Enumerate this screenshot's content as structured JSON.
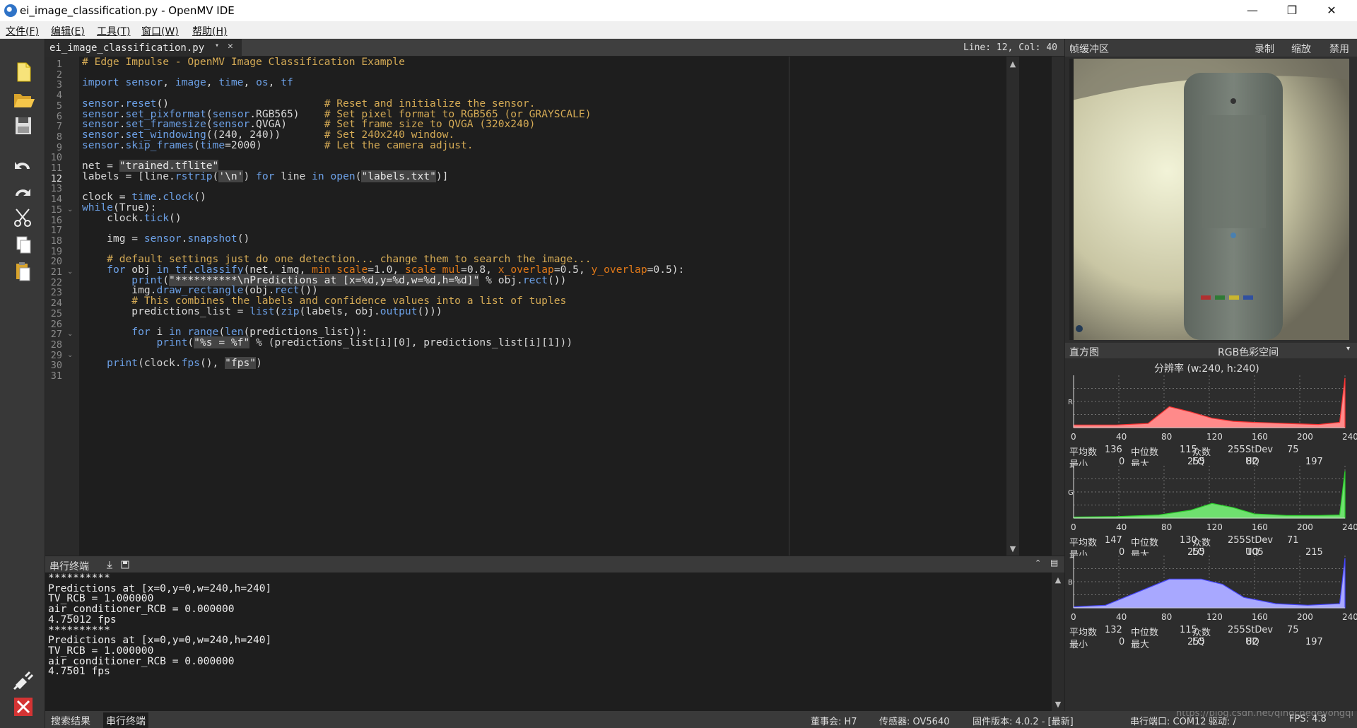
{
  "window": {
    "title": "ei_image_classification.py - OpenMV IDE"
  },
  "menu": [
    "文件(F)",
    "编辑(E)",
    "工具(T)",
    "窗口(W)",
    "帮助(H)"
  ],
  "tab": {
    "name": "ei_image_classification.py",
    "position": "Line: 12, Col: 40"
  },
  "editor": {
    "line_numbers": [
      "1",
      "2",
      "3",
      "4",
      "5",
      "6",
      "7",
      "8",
      "9",
      "10",
      "11",
      "12",
      "13",
      "14",
      "15",
      "16",
      "17",
      "18",
      "19",
      "20",
      "21",
      "22",
      "23",
      "24",
      "25",
      "26",
      "27",
      "28",
      "29",
      "30",
      "31"
    ],
    "lines": [
      "# Edge Impulse - OpenMV Image Classification Example",
      "",
      "import sensor, image, time, os, tf",
      "",
      "sensor.reset()                         # Reset and initialize the sensor.",
      "sensor.set_pixformat(sensor.RGB565)    # Set pixel format to RGB565 (or GRAYSCALE)",
      "sensor.set_framesize(sensor.QVGA)      # Set frame size to QVGA (320x240)",
      "sensor.set_windowing((240, 240))       # Set 240x240 window.",
      "sensor.skip_frames(time=2000)          # Let the camera adjust.",
      "",
      "net = \"trained.tflite\"",
      "labels = [line.rstrip('\\n') for line in open(\"labels.txt\")]",
      "",
      "clock = time.clock()",
      "while(True):",
      "    clock.tick()",
      "",
      "    img = sensor.snapshot()",
      "",
      "    # default settings just do one detection... change them to search the image...",
      "    for obj in tf.classify(net, img, min_scale=1.0, scale_mul=0.8, x_overlap=0.5, y_overlap=0.5):",
      "        print(\"**********\\nPredictions at [x=%d,y=%d,w=%d,h=%d]\" % obj.rect())",
      "        img.draw_rectangle(obj.rect())",
      "        # This combines the labels and confidence values into a list of tuples",
      "        predictions_list = list(zip(labels, obj.output()))",
      "",
      "        for i in range(len(predictions_list)):",
      "            print(\"%s = %f\" % (predictions_list[i][0], predictions_list[i][1]))",
      "",
      "    print(clock.fps(), \"fps\")",
      ""
    ]
  },
  "terminal": {
    "title": "串行终端",
    "lines": [
      "**********",
      "Predictions at [x=0,y=0,w=240,h=240]",
      "TV_RCB = 1.000000",
      "air_conditioner_RCB = 0.000000",
      "4.75012 fps",
      "**********",
      "Predictions at [x=0,y=0,w=240,h=240]",
      "TV_RCB = 1.000000",
      "air_conditioner_RCB = 0.000000",
      "4.7501 fps"
    ]
  },
  "bottom_tabs": [
    "搜索结果",
    "串行终端"
  ],
  "status": {
    "board": "董事会: H7",
    "sensor": "传感器: OV5640",
    "firmware": "固件版本: 4.0.2 - [最新]",
    "port": "串行端口: COM12",
    "drive": "驱动: /",
    "fps": "FPS: 4.8",
    "watermark": "https://blog.csdn.net/qingchedeyongqi"
  },
  "framebuffer": {
    "title": "帧缓冲区",
    "buttons": [
      "录制",
      "缩放",
      "禁用"
    ]
  },
  "histogram": {
    "title": "直方图",
    "colorspace": "RGB色彩空间",
    "resolution": "分辨率 (w:240, h:240)",
    "axis_ticks": [
      "0",
      "40",
      "80",
      "120",
      "160",
      "200",
      "240"
    ],
    "channels": [
      {
        "label": "R",
        "color": "#ff8a8a",
        "line": "#ff3333",
        "stats": {
          "mean": "136",
          "median": "115",
          "mode": "255",
          "stdev": "75",
          "min": "0",
          "max": "255",
          "lq": "82",
          "uq": "197"
        }
      },
      {
        "label": "G",
        "color": "#6fe06f",
        "line": "#2ccd2c",
        "stats": {
          "mean": "147",
          "median": "130",
          "mode": "255",
          "stdev": "71",
          "min": "0",
          "max": "255",
          "lq": "105",
          "uq": "215"
        }
      },
      {
        "label": "B",
        "color": "#a8a8ff",
        "line": "#4444ff",
        "stats": {
          "mean": "132",
          "median": "115",
          "mode": "255",
          "stdev": "75",
          "min": "0",
          "max": "255",
          "lq": "82",
          "uq": "197"
        }
      }
    ],
    "stat_labels": {
      "mean": "平均数",
      "median": "中位数",
      "mode": "众数",
      "stdev": "StDev",
      "min": "最小",
      "max": "最大",
      "lq": "LQ",
      "uq": "UQ"
    }
  }
}
